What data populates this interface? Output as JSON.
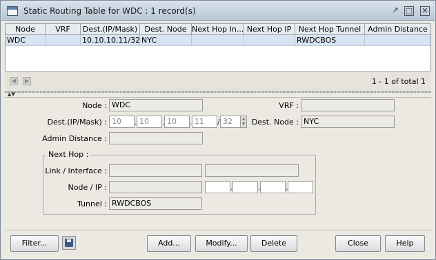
{
  "window": {
    "title": "Static Routing Table for WDC : 1 record(s)"
  },
  "table": {
    "columns": [
      "Node",
      "VRF",
      "Dest.(IP/Mask)",
      "Dest. Node",
      "Next Hop In...",
      "Next Hop IP",
      "Next Hop Tunnel",
      "Admin Distance"
    ],
    "rows": [
      [
        "WDC",
        "",
        "10.10.10.11/32",
        "NYC",
        "",
        "",
        "RWDCBOS",
        ""
      ]
    ]
  },
  "pager": {
    "status": "1 - 1 of total 1"
  },
  "form": {
    "node_label": "Node :",
    "node_value": "WDC",
    "vrf_label": "VRF :",
    "vrf_value": "",
    "dest_label": "Dest.(IP/Mask) :",
    "dest_octets": [
      "10",
      "10",
      "10",
      "11"
    ],
    "dest_mask": "32",
    "dest_node_label": "Dest. Node :",
    "dest_node_value": "NYC",
    "admin_distance_label": "Admin Distance :",
    "admin_distance_value": "",
    "next_hop": {
      "title": "Next Hop :",
      "link_label": "Link / Interface :",
      "link_value": "",
      "link_value2": "",
      "node_ip_label": "Node / IP :",
      "node_ip_node": "",
      "ip_octets": [
        "",
        "",
        "",
        ""
      ],
      "tunnel_label": "Tunnel :",
      "tunnel_value": "RWDCBOS"
    }
  },
  "buttons": {
    "filter": "Filter...",
    "add": "Add...",
    "modify": "Modify...",
    "delete": "Delete",
    "close": "Close",
    "help": "Help"
  },
  "icons": {
    "window": "window-icon",
    "minimize": "undock-icon",
    "maximize": "maximize-icon",
    "close": "close-icon",
    "save": "save-icon",
    "prev": "prev-page-icon",
    "next": "next-page-icon"
  },
  "colors": {
    "selected_row": "#d8e4f2",
    "title_bar": "#c4d1de",
    "background": "#ece9e3"
  }
}
